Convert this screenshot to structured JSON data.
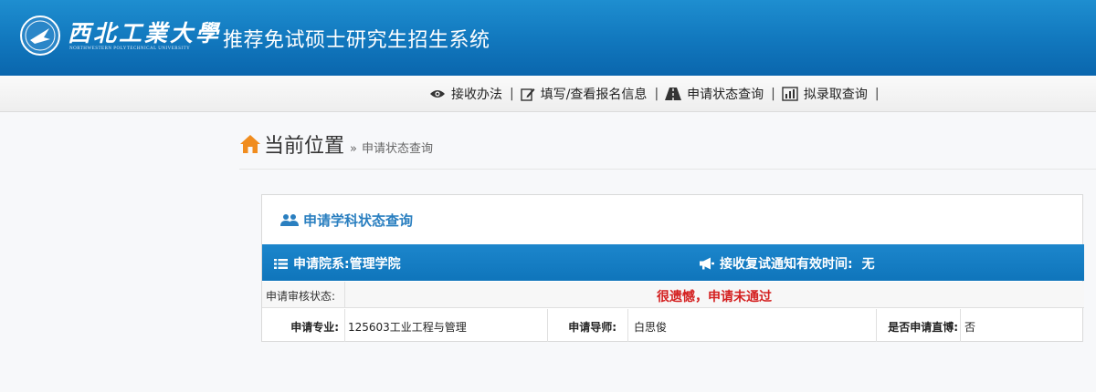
{
  "header": {
    "logo_name": "西北工業大學",
    "logo_subtitle": "NORTHWESTERN POLYTECHNICAL UNIVERSITY",
    "system_title": "推荐免试硕士研究生招生系统"
  },
  "nav": {
    "items": [
      {
        "label": "接收办法",
        "icon": "eye-icon"
      },
      {
        "label": "填写/查看报名信息",
        "icon": "edit-icon"
      },
      {
        "label": "申请状态查询",
        "icon": "road-icon"
      },
      {
        "label": "拟录取查询",
        "icon": "bar-chart-icon"
      }
    ],
    "separator": "|"
  },
  "breadcrumb": {
    "title": "当前位置",
    "arrow": "»",
    "current": "申请状态查询"
  },
  "panel": {
    "title": "申请学科状态查询",
    "department_label": "申请院系:",
    "department_value": "管理学院",
    "notice_label": "接收复试通知有效时间:",
    "notice_value": "无",
    "status_label": "申请审核状态:",
    "status_value": "很遗憾，申请未通过",
    "major_label": "申请专业:",
    "major_value": "125603工业工程与管理",
    "advisor_label": "申请导师:",
    "advisor_value": "白思俊",
    "phd_label": "是否申请直博:",
    "phd_value": "否"
  },
  "colors": {
    "header_blue": "#1177bd",
    "bar_blue": "#1c86cc",
    "status_red": "#d42020",
    "title_blue": "#2a7fc0",
    "home_orange": "#f08c1e"
  }
}
